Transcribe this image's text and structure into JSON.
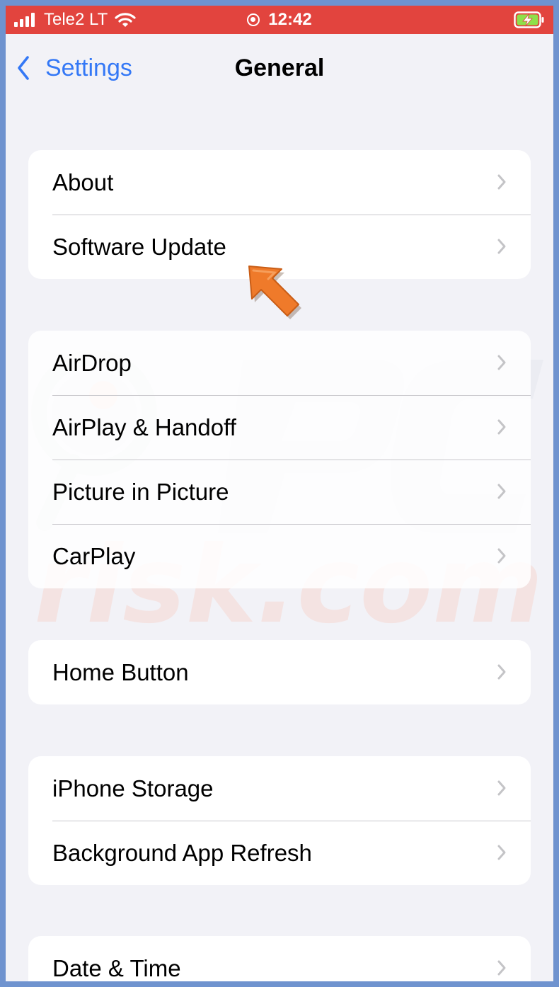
{
  "status_bar": {
    "carrier": "Tele2 LT",
    "time": "12:42",
    "background_color": "#e2443e",
    "battery_color": "#8ee04a"
  },
  "nav": {
    "back_label": "Settings",
    "title": "General",
    "accent_color": "#3478f6"
  },
  "groups": [
    {
      "rows": [
        {
          "label": "About"
        },
        {
          "label": "Software Update"
        }
      ]
    },
    {
      "rows": [
        {
          "label": "AirDrop"
        },
        {
          "label": "AirPlay & Handoff"
        },
        {
          "label": "Picture in Picture"
        },
        {
          "label": "CarPlay"
        }
      ]
    },
    {
      "rows": [
        {
          "label": "Home Button"
        }
      ]
    },
    {
      "rows": [
        {
          "label": "iPhone Storage"
        },
        {
          "label": "Background App Refresh"
        }
      ]
    },
    {
      "rows": [
        {
          "label": "Date & Time"
        }
      ]
    }
  ],
  "annotation": {
    "icon": "orange-pointer-arrow-icon",
    "color": "#ef7a2a"
  },
  "watermark": {
    "text": "risk.com",
    "logo": "pc-magnifier-logo"
  }
}
